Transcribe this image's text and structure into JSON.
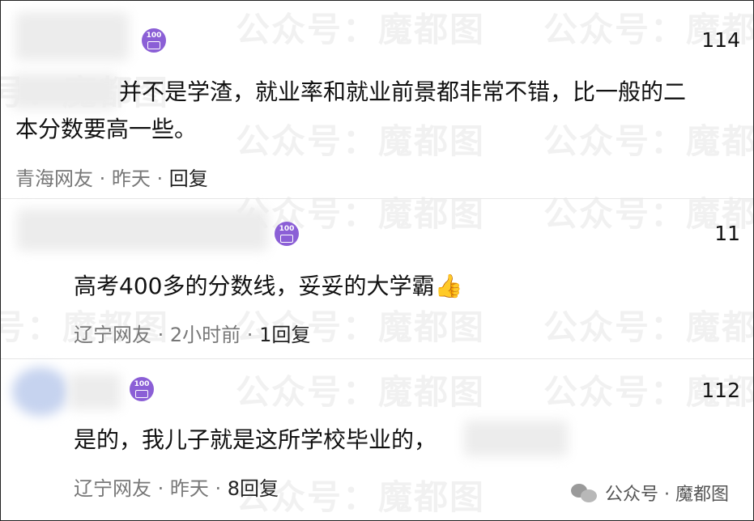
{
  "watermark": "公众号：魔都图",
  "comments": [
    {
      "badge_number": "100",
      "likes": "114",
      "text_line1": "并不是学渣，就业率和就业前景都非常不错，比一般的二",
      "text_line2": "本分数要高一些。",
      "location": "青海网友",
      "time": "昨天",
      "reply": "回复"
    },
    {
      "badge_number": "100",
      "likes": "11",
      "text": "高考400多的分数线，妥妥的大学霸",
      "emoji": "👍",
      "location": "辽宁网友",
      "time": "2小时前",
      "reply": "1回复"
    },
    {
      "badge_number": "100",
      "likes": "112",
      "text": "是的，我儿子就是这所学校毕业的，",
      "location": "辽宁网友",
      "time": "昨天",
      "reply": "8回复"
    }
  ],
  "footer": {
    "label": "公众号 · 魔都图"
  },
  "colors": {
    "badge": "#8b5fd6",
    "meta": "#777777"
  }
}
